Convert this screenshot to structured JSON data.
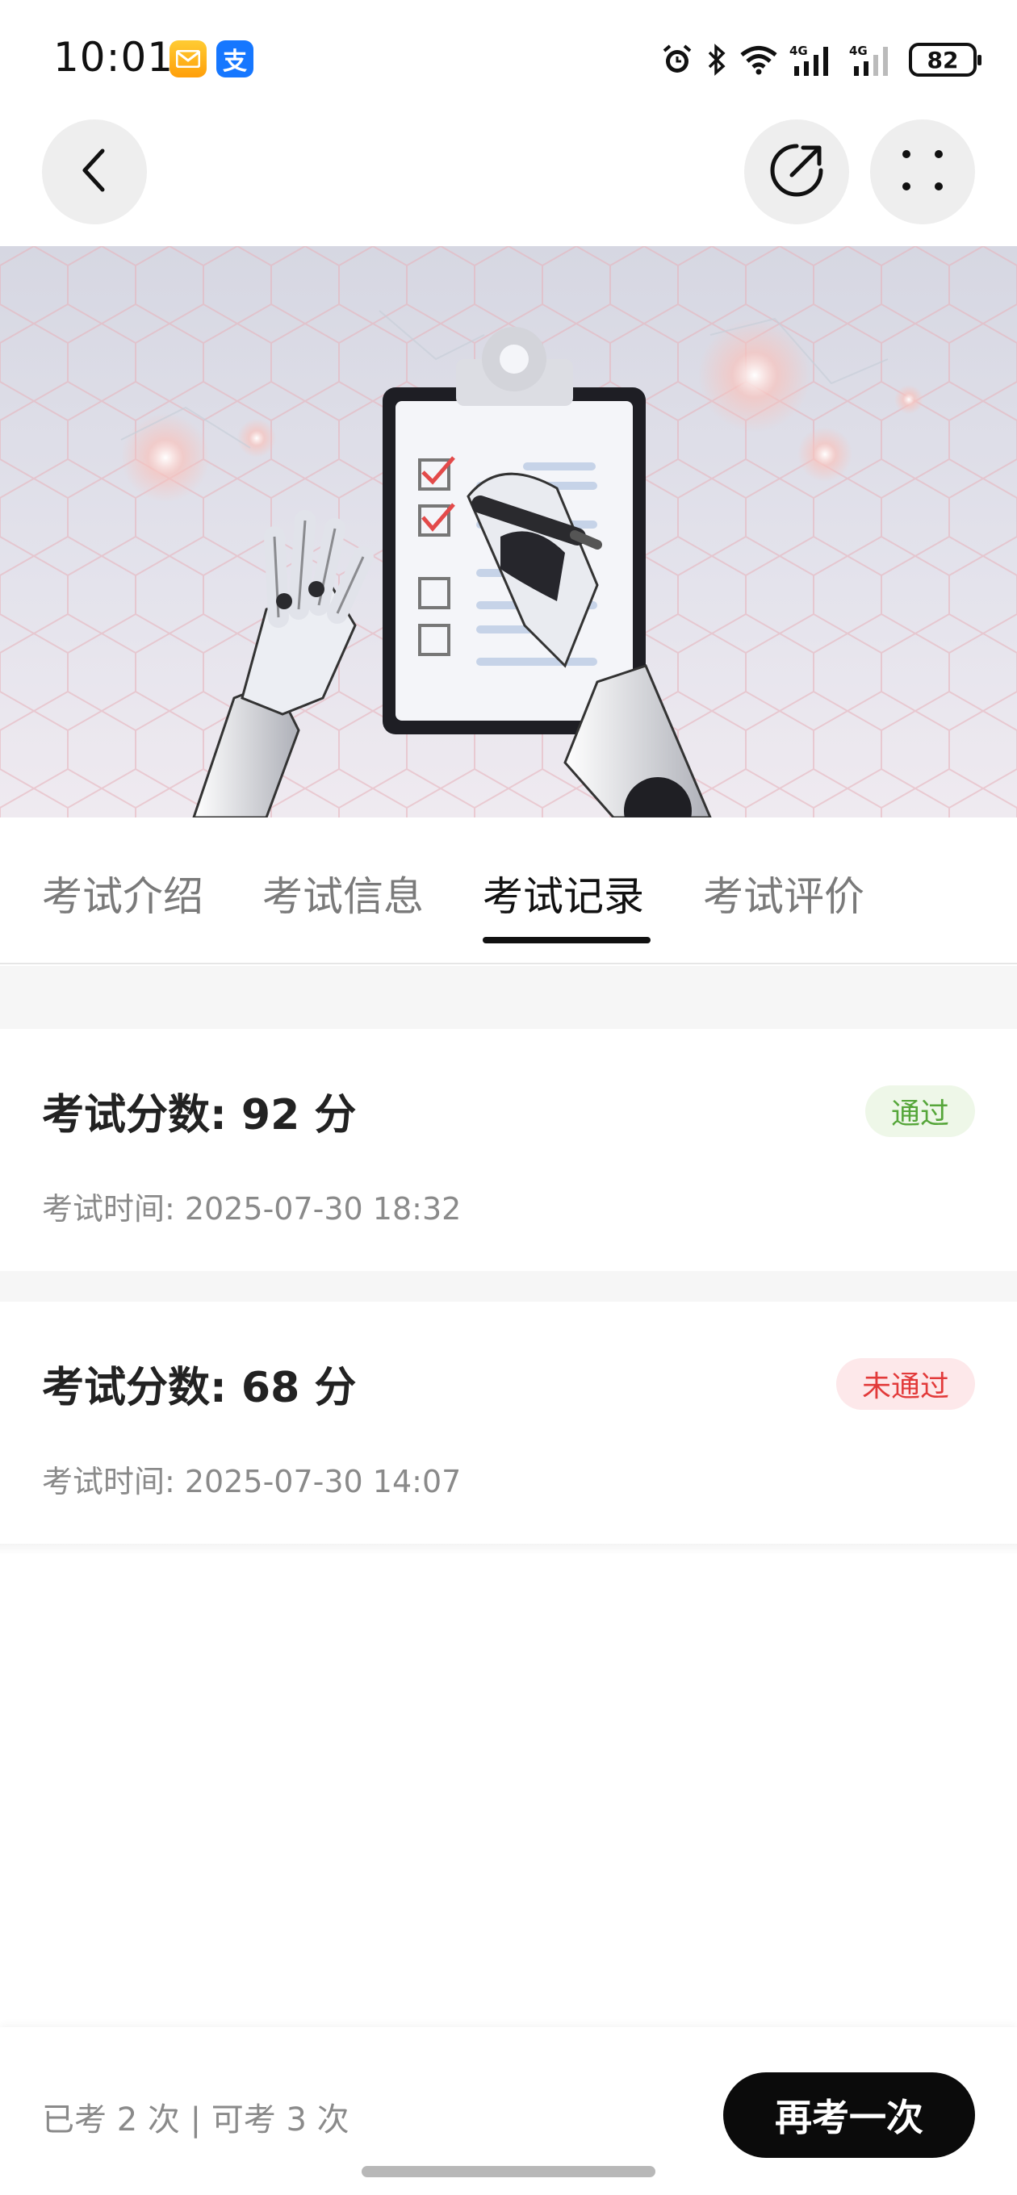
{
  "status_bar": {
    "time": "10:01",
    "app_badges": [
      "mail-app-icon",
      "alipay-icon"
    ],
    "pay_badge_text": "支",
    "icons": [
      "alarm-icon",
      "bluetooth-icon",
      "wifi-icon",
      "signal-4g-icon",
      "signal-4g-icon"
    ],
    "network_label_1": "4G",
    "network_label_2": "4G",
    "battery": "82"
  },
  "nav": {
    "back_icon": "chevron-left-icon",
    "share_icon": "share-icon",
    "more_icon": "more-icon"
  },
  "tabs": [
    {
      "label": "考试介绍",
      "active": false
    },
    {
      "label": "考试信息",
      "active": false
    },
    {
      "label": "考试记录",
      "active": true
    },
    {
      "label": "考试评价",
      "active": false
    }
  ],
  "records": [
    {
      "score_label": "考试分数: 92 分",
      "time_label": "考试时间: 2025-07-30 18:32",
      "status": "通过",
      "status_color": "#56a63a"
    },
    {
      "score_label": "考试分数: 68 分",
      "time_label": "考试时间: 2025-07-30 14:07",
      "status": "未通过",
      "status_color": "#e23a3a"
    }
  ],
  "footer": {
    "attempts": "已考 2 次 | 可考 3 次",
    "retake_label": "再考一次"
  },
  "colors": {
    "accent": "#0b0b0b",
    "pass": "#56a63a",
    "fail": "#e23a3a"
  }
}
